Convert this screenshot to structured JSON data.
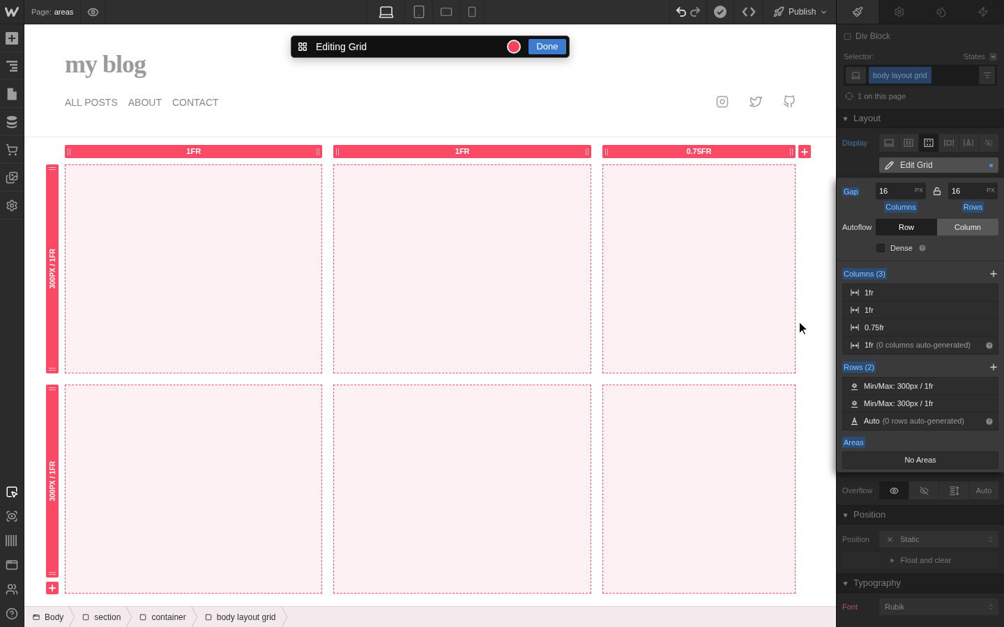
{
  "left_toolbar": {
    "top_tools": [
      {
        "selected": false
      },
      {
        "selected": false
      },
      {
        "selected": false
      },
      {
        "selected": false
      },
      {
        "selected": false
      },
      {
        "selected": false
      },
      {
        "selected": false
      }
    ],
    "bottom_tools": [
      {
        "selected": true
      },
      {
        "selected": false
      },
      {
        "selected": false
      },
      {
        "selected": false
      },
      {
        "selected": false
      },
      {
        "selected": false
      }
    ]
  },
  "top_bar": {
    "page_label": "Page:",
    "page_name": "areas",
    "devices": [
      {
        "selected": true
      },
      {
        "selected": false
      },
      {
        "selected": false
      },
      {
        "selected": false
      }
    ],
    "publish": "Publish"
  },
  "site": {
    "logo": "my blog",
    "nav": [
      "ALL POSTS",
      "ABOUT",
      "CONTACT"
    ]
  },
  "editing_bar": {
    "title": "Editing Grid",
    "done": "Done"
  },
  "grid": {
    "columns": [
      {
        "label": "1FR"
      },
      {
        "label": "1FR"
      },
      {
        "label": "0.75FR"
      }
    ],
    "rows": [
      {
        "label": "300PX / 1FR"
      },
      {
        "label": "300PX / 1FR"
      }
    ]
  },
  "breadcrumbs": [
    "Body",
    "section",
    "container",
    "body layout grid"
  ],
  "panel_tabs": [
    {
      "selected": true
    },
    {
      "selected": false
    },
    {
      "selected": false
    },
    {
      "selected": false
    }
  ],
  "element": {
    "type": "Div Block",
    "selector_label": "Selector:",
    "states_label": "States",
    "class_name": "body layout grid",
    "usage": "1 on this page"
  },
  "layout": {
    "title": "Layout",
    "expanded": true,
    "display_label": "Display",
    "display_options": [
      {
        "selected": false
      },
      {
        "selected": false
      },
      {
        "selected": true
      },
      {
        "selected": false
      },
      {
        "selected": false
      },
      {
        "selected": false
      }
    ],
    "edit_grid": "Edit Grid"
  },
  "grid_settings": {
    "gap_label": "Gap",
    "gap": [
      {
        "value": "16",
        "unit": "PX",
        "label": "Columns"
      },
      {
        "value": "16",
        "unit": "PX",
        "label": "Rows"
      }
    ],
    "autoflow_label": "Autoflow",
    "autoflow": [
      {
        "label": "Row",
        "selected": true
      },
      {
        "label": "Column",
        "selected": false
      }
    ],
    "dense": {
      "label": "Dense",
      "checked": false
    },
    "columns_title": "Columns (3)",
    "columns": [
      {
        "value": "1fr"
      },
      {
        "value": "1fr"
      },
      {
        "value": "0.75fr"
      },
      {
        "value": "1fr",
        "note": "(0 columns auto-generated)"
      }
    ],
    "rows_title": "Rows (2)",
    "rows": [
      {
        "kind": "minmax",
        "value": "Min/Max: 300px / 1fr"
      },
      {
        "kind": "minmax",
        "value": "Min/Max: 300px / 1fr"
      },
      {
        "kind": "auto",
        "value": "Auto",
        "note": "(0 rows auto-generated)"
      }
    ],
    "areas_title": "Areas",
    "areas_empty": "No Areas"
  },
  "overflow": {
    "label": "Overflow",
    "options": [
      {
        "selected": true
      },
      {
        "selected": false
      },
      {
        "selected": false
      },
      {
        "label": "Auto",
        "selected": false
      }
    ]
  },
  "position": {
    "title": "Position",
    "expanded": true,
    "label": "Position",
    "value": "Static",
    "float_clear": {
      "label": "Float and clear",
      "expanded": false
    }
  },
  "typography": {
    "title": "Typography",
    "expanded": true,
    "font_label": "Font",
    "font_value": "Rubik"
  }
}
